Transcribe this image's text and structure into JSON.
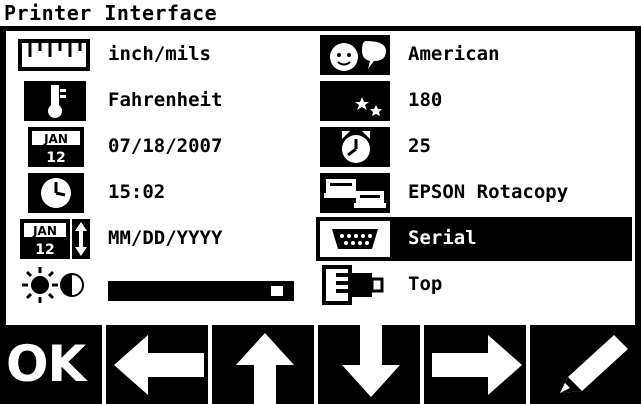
{
  "header": {
    "title": "Printer Interface"
  },
  "settings": {
    "units": "inch/mils",
    "temperature": "Fahrenheit",
    "date": "07/18/2007",
    "time": "15:02",
    "date_format": "MM/DD/YYYY",
    "brightness_level": 0.95,
    "language": "American",
    "sleep_timeout": "180",
    "alarm_value": "25",
    "printer_model": "EPSON Rotacopy",
    "interface": "Serial",
    "paper_feed": "Top"
  },
  "icons": {
    "calendar_month": "JAN",
    "calendar_day": "12"
  },
  "toolbar": {
    "ok_label": "OK",
    "buttons": [
      "ok",
      "left-arrow",
      "up-arrow",
      "down-arrow",
      "right-arrow",
      "edit-pencil"
    ]
  },
  "colors": {
    "foreground": "#000000",
    "background": "#ffffff"
  }
}
